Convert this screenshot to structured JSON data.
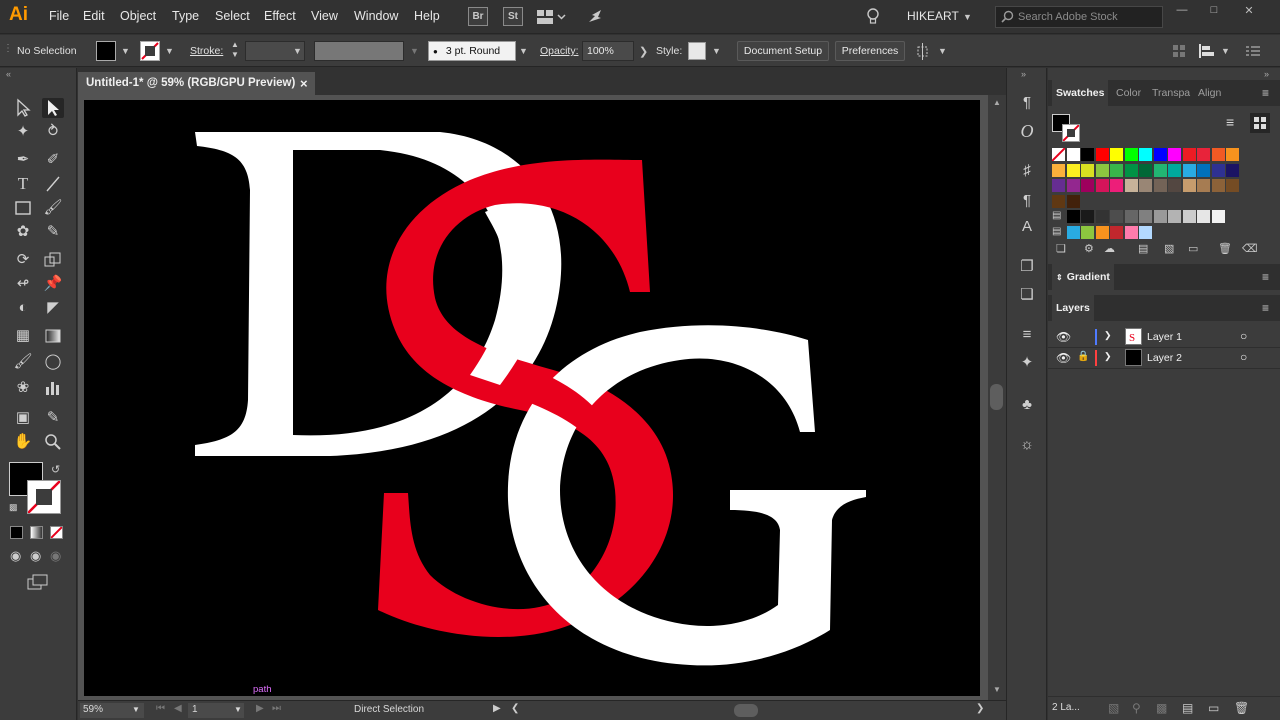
{
  "app": {
    "logo": "Ai"
  },
  "menu": [
    "File",
    "Edit",
    "Object",
    "Type",
    "Select",
    "Effect",
    "View",
    "Window",
    "Help"
  ],
  "bridge_label": "Br",
  "stock_label": "St",
  "workspace": "HIKEART",
  "search": {
    "placeholder": "Search Adobe Stock"
  },
  "control": {
    "selection_label": "No Selection",
    "stroke_label": "Stroke:",
    "brush_label": "3 pt. Round",
    "opacity_label": "Opacity:",
    "opacity_value": "100%",
    "style_label": "Style:",
    "doc_setup": "Document Setup",
    "preferences": "Preferences"
  },
  "document": {
    "tab_title": "Untitled-1* @ 59% (RGB/GPU Preview)",
    "close": "×"
  },
  "artwork": {
    "letters": [
      "D",
      "S",
      "G"
    ],
    "colors": {
      "white": "#ffffff",
      "red": "#e8001c",
      "bg": "#000000"
    }
  },
  "tooltip": "path",
  "status": {
    "zoom": "59%",
    "page": "1",
    "tool": "Direct Selection"
  },
  "panels": {
    "top_tabs": [
      "Swatches",
      "Color",
      "Transpa",
      "Align"
    ],
    "gradient": "Gradient",
    "layers_title": "Layers",
    "layers": [
      {
        "name": "Layer 1",
        "color": "#4f7bff",
        "locked": false
      },
      {
        "name": "Layer 2",
        "color": "#ff4040",
        "locked": true
      }
    ],
    "layers_count": "2 La..."
  },
  "swatches": {
    "row1": [
      "#ffffff",
      "#ffffff",
      "#000000",
      "#ff0000",
      "#ffff00",
      "#00ff00",
      "#00ffff",
      "#0000ff",
      "#ff00ff",
      "#ed1c24",
      "#e8233a",
      "#f15a24",
      "#f7931e"
    ],
    "row2": [
      "#fbb03b",
      "#fcee21",
      "#d9e021",
      "#8cc63f",
      "#39b54a",
      "#009245",
      "#006837",
      "#22b573",
      "#00a99d",
      "#29abe2",
      "#0071bc",
      "#2e3192",
      "#1b1464"
    ],
    "row3": [
      "#662d91",
      "#93278f",
      "#9e005d",
      "#d4145a",
      "#ed1e79",
      "#c7b299",
      "#998675",
      "#736357",
      "#534741",
      "#c69c6d",
      "#a67c52",
      "#8c6239",
      "#754c24"
    ],
    "row4": [
      "#603813",
      "#42210b"
    ],
    "gray_row": [
      "#000000",
      "#1a1a1a",
      "#333333",
      "#4d4d4d",
      "#666666",
      "#808080",
      "#999999",
      "#b3b3b3",
      "#cccccc",
      "#e6e6e6",
      "#f2f2f2"
    ],
    "extra_row": [
      "#29abe2",
      "#8cc63f",
      "#f7931e",
      "#c1272d",
      "#ff7bac",
      "#b3d9ff"
    ]
  }
}
